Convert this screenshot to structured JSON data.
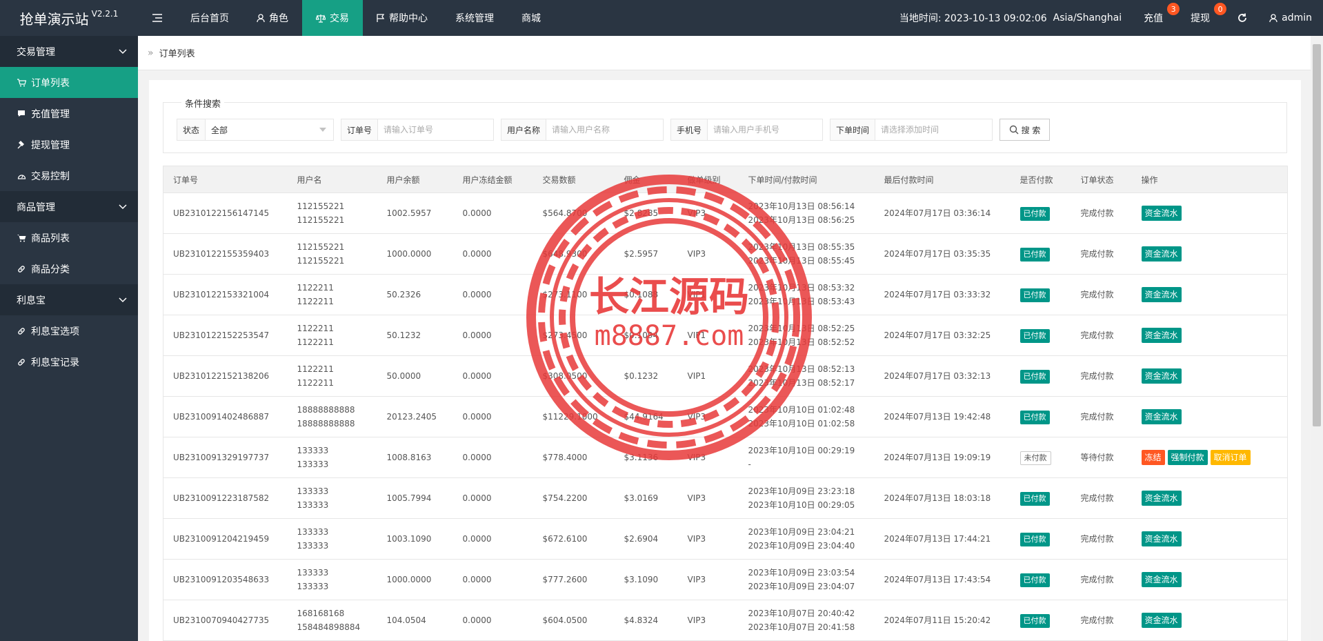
{
  "app": {
    "title": "抢单演示站",
    "version": "V2.2.1"
  },
  "topnav": [
    {
      "label": "后台首页",
      "icon": ""
    },
    {
      "label": "角色",
      "icon": "person-icon"
    },
    {
      "label": "交易",
      "icon": "scale-icon"
    },
    {
      "label": "帮助中心",
      "icon": "flag-icon"
    },
    {
      "label": "系统管理",
      "icon": ""
    },
    {
      "label": "商城",
      "icon": ""
    }
  ],
  "topright": {
    "time_label": "当地时间: 2023-10-13 09:02:06",
    "timezone": "Asia/Shanghai",
    "recharge_label": "充值",
    "recharge_count": "3",
    "withdraw_label": "提现",
    "withdraw_count": "0",
    "user": "admin"
  },
  "sidebar": {
    "groups": [
      {
        "label": "交易管理",
        "items": [
          "订单列表",
          "充值管理",
          "提现管理",
          "交易控制"
        ]
      },
      {
        "label": "商品管理",
        "items": [
          "商品列表",
          "商品分类"
        ]
      },
      {
        "label": "利息宝",
        "items": [
          "利息宝选项",
          "利息宝记录"
        ]
      }
    ]
  },
  "breadcrumb": {
    "current": "订单列表"
  },
  "search": {
    "legend": "条件搜索",
    "status_label": "状态",
    "status_value": "全部",
    "order_label": "订单号",
    "order_placeholder": "请输入订单号",
    "username_label": "用户名称",
    "username_placeholder": "请输入用户名称",
    "phone_label": "手机号",
    "phone_placeholder": "请输入用户手机号",
    "time_label": "下单时间",
    "time_placeholder": "请选择添加时间",
    "button_label": "搜 索"
  },
  "table": {
    "headers": [
      "订单号",
      "用户名",
      "用户余额",
      "用户冻结金额",
      "交易数额",
      "佣金",
      "做单级别",
      "下单时间/付款时间",
      "最后付款时间",
      "是否付款",
      "订单状态",
      "操作"
    ],
    "rows": [
      {
        "order": "UB2310122156147145",
        "user1": "112155221",
        "user2": "112155221",
        "balance": "1002.5957",
        "frozen": "0.0000",
        "amount": "$564.8700",
        "commission": "$2.8285",
        "level": "VIP3",
        "time1": "2023年10月13日 08:56:14",
        "time2": "2023年10月13日 08:56:25",
        "last": "2024年07月17日 03:36:14",
        "paid": "已付款",
        "status": "完成付款"
      },
      {
        "order": "UB2310122155359403",
        "user1": "112155221",
        "user2": "112155221",
        "balance": "1000.0000",
        "frozen": "0.0000",
        "amount": "$648.9300",
        "commission": "$2.5957",
        "level": "VIP3",
        "time1": "2023年10月13日 08:55:35",
        "time2": "2023年10月13日 08:55:45",
        "last": "2024年07月17日 03:35:35",
        "paid": "已付款",
        "status": "完成付款"
      },
      {
        "order": "UB2310122153321004",
        "user1": "1122211",
        "user2": "1122211",
        "balance": "50.2326",
        "frozen": "0.0000",
        "amount": "$273.1100",
        "commission": "$0.1088",
        "level": "VIP1",
        "time1": "2023年10月13日 08:53:32",
        "time2": "2023年10月13日 08:53:43",
        "last": "2024年07月17日 03:33:32",
        "paid": "已付款",
        "status": "完成付款"
      },
      {
        "order": "UB2310122152253547",
        "user1": "1122211",
        "user2": "1122211",
        "balance": "50.1232",
        "frozen": "0.0000",
        "amount": "$273.4500",
        "commission": "$0.1094",
        "level": "VIP1",
        "time1": "2023年10月13日 08:52:25",
        "time2": "2023年10月13日 08:52:52",
        "last": "2024年07月17日 03:32:25",
        "paid": "已付款",
        "status": "完成付款"
      },
      {
        "order": "UB2310122152138206",
        "user1": "1122211",
        "user2": "1122211",
        "balance": "50.0000",
        "frozen": "0.0000",
        "amount": "$308.0500",
        "commission": "$0.1232",
        "level": "VIP1",
        "time1": "2023年10月13日 08:52:13",
        "time2": "2023年10月13日 08:52:17",
        "last": "2024年07月17日 03:32:13",
        "paid": "已付款",
        "status": "完成付款"
      },
      {
        "order": "UB2310091402486887",
        "user1": "18888888888",
        "user2": "18888888888",
        "balance": "20123.2405",
        "frozen": "0.0000",
        "amount": "$11229.1000",
        "commission": "$44.9164",
        "level": "VIP3",
        "time1": "2023年10月10日 01:02:48",
        "time2": "2023年10月10日 01:02:58",
        "last": "2024年07月13日 19:42:48",
        "paid": "已付款",
        "status": "完成付款"
      },
      {
        "order": "UB2310091329197737",
        "user1": "133333",
        "user2": "133333",
        "balance": "1008.8163",
        "frozen": "0.0000",
        "amount": "$778.4000",
        "commission": "$3.1136",
        "level": "VIP3",
        "time1": "2023年10月10日 00:29:19",
        "time2": "-",
        "last": "2024年07月13日 19:09:19",
        "paid": "未付款",
        "status": "等待付款",
        "pending": true
      },
      {
        "order": "UB2310091223187582",
        "user1": "133333",
        "user2": "133333",
        "balance": "1005.7994",
        "frozen": "0.0000",
        "amount": "$754.2200",
        "commission": "$3.0169",
        "level": "VIP3",
        "time1": "2023年10月09日 23:23:18",
        "time2": "2023年10月10日 00:29:05",
        "last": "2024年07月13日 18:03:18",
        "paid": "已付款",
        "status": "完成付款"
      },
      {
        "order": "UB2310091204219459",
        "user1": "133333",
        "user2": "133333",
        "balance": "1003.1090",
        "frozen": "0.0000",
        "amount": "$672.6100",
        "commission": "$2.6904",
        "level": "VIP3",
        "time1": "2023年10月09日 23:04:21",
        "time2": "2023年10月09日 23:04:40",
        "last": "2024年07月13日 17:44:21",
        "paid": "已付款",
        "status": "完成付款"
      },
      {
        "order": "UB2310091203548633",
        "user1": "133333",
        "user2": "133333",
        "balance": "1000.0000",
        "frozen": "0.0000",
        "amount": "$777.2600",
        "commission": "$3.1090",
        "level": "VIP3",
        "time1": "2023年10月09日 23:03:54",
        "time2": "2023年10月09日 23:04:07",
        "last": "2024年07月13日 17:43:54",
        "paid": "已付款",
        "status": "完成付款"
      },
      {
        "order": "UB2310070940427735",
        "user1": "168168168",
        "user2": "158484898884",
        "balance": "104.0504",
        "frozen": "0.0000",
        "amount": "$604.0500",
        "commission": "$4.8324",
        "level": "VIP3",
        "time1": "2023年10月07日 20:40:42",
        "time2": "2023年10月07日 20:41:58",
        "last": "2024年07月11日 15:20:42",
        "paid": "已付款",
        "status": "完成付款"
      }
    ],
    "actions": {
      "flow": "资金流水",
      "freeze": "冻结",
      "force_pay": "强制付款",
      "cancel": "取消订单"
    }
  },
  "watermark": {
    "title": "长江源码",
    "url": "m8887.com"
  },
  "colors": {
    "sidebar": "#2a3542",
    "accent": "#16a085",
    "paid": "#009688",
    "danger": "#ff5722",
    "warn": "#ffb800",
    "stamp": "#e83a3a"
  }
}
